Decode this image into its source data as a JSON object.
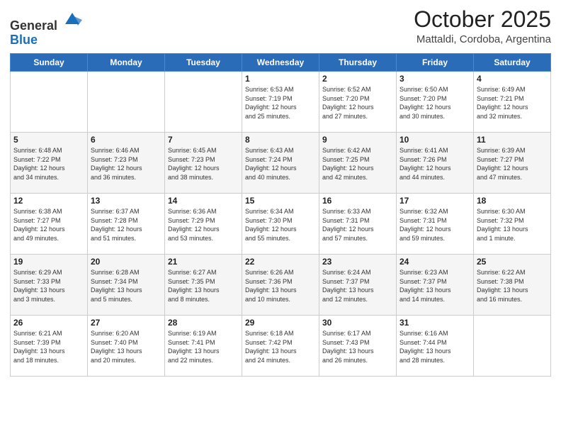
{
  "header": {
    "logo_line1": "General",
    "logo_line2": "Blue",
    "month": "October 2025",
    "location": "Mattaldi, Cordoba, Argentina"
  },
  "days_of_week": [
    "Sunday",
    "Monday",
    "Tuesday",
    "Wednesday",
    "Thursday",
    "Friday",
    "Saturday"
  ],
  "weeks": [
    [
      {
        "day": "",
        "info": ""
      },
      {
        "day": "",
        "info": ""
      },
      {
        "day": "",
        "info": ""
      },
      {
        "day": "1",
        "info": "Sunrise: 6:53 AM\nSunset: 7:19 PM\nDaylight: 12 hours\nand 25 minutes."
      },
      {
        "day": "2",
        "info": "Sunrise: 6:52 AM\nSunset: 7:20 PM\nDaylight: 12 hours\nand 27 minutes."
      },
      {
        "day": "3",
        "info": "Sunrise: 6:50 AM\nSunset: 7:20 PM\nDaylight: 12 hours\nand 30 minutes."
      },
      {
        "day": "4",
        "info": "Sunrise: 6:49 AM\nSunset: 7:21 PM\nDaylight: 12 hours\nand 32 minutes."
      }
    ],
    [
      {
        "day": "5",
        "info": "Sunrise: 6:48 AM\nSunset: 7:22 PM\nDaylight: 12 hours\nand 34 minutes."
      },
      {
        "day": "6",
        "info": "Sunrise: 6:46 AM\nSunset: 7:23 PM\nDaylight: 12 hours\nand 36 minutes."
      },
      {
        "day": "7",
        "info": "Sunrise: 6:45 AM\nSunset: 7:23 PM\nDaylight: 12 hours\nand 38 minutes."
      },
      {
        "day": "8",
        "info": "Sunrise: 6:43 AM\nSunset: 7:24 PM\nDaylight: 12 hours\nand 40 minutes."
      },
      {
        "day": "9",
        "info": "Sunrise: 6:42 AM\nSunset: 7:25 PM\nDaylight: 12 hours\nand 42 minutes."
      },
      {
        "day": "10",
        "info": "Sunrise: 6:41 AM\nSunset: 7:26 PM\nDaylight: 12 hours\nand 44 minutes."
      },
      {
        "day": "11",
        "info": "Sunrise: 6:39 AM\nSunset: 7:27 PM\nDaylight: 12 hours\nand 47 minutes."
      }
    ],
    [
      {
        "day": "12",
        "info": "Sunrise: 6:38 AM\nSunset: 7:27 PM\nDaylight: 12 hours\nand 49 minutes."
      },
      {
        "day": "13",
        "info": "Sunrise: 6:37 AM\nSunset: 7:28 PM\nDaylight: 12 hours\nand 51 minutes."
      },
      {
        "day": "14",
        "info": "Sunrise: 6:36 AM\nSunset: 7:29 PM\nDaylight: 12 hours\nand 53 minutes."
      },
      {
        "day": "15",
        "info": "Sunrise: 6:34 AM\nSunset: 7:30 PM\nDaylight: 12 hours\nand 55 minutes."
      },
      {
        "day": "16",
        "info": "Sunrise: 6:33 AM\nSunset: 7:31 PM\nDaylight: 12 hours\nand 57 minutes."
      },
      {
        "day": "17",
        "info": "Sunrise: 6:32 AM\nSunset: 7:31 PM\nDaylight: 12 hours\nand 59 minutes."
      },
      {
        "day": "18",
        "info": "Sunrise: 6:30 AM\nSunset: 7:32 PM\nDaylight: 13 hours\nand 1 minute."
      }
    ],
    [
      {
        "day": "19",
        "info": "Sunrise: 6:29 AM\nSunset: 7:33 PM\nDaylight: 13 hours\nand 3 minutes."
      },
      {
        "day": "20",
        "info": "Sunrise: 6:28 AM\nSunset: 7:34 PM\nDaylight: 13 hours\nand 5 minutes."
      },
      {
        "day": "21",
        "info": "Sunrise: 6:27 AM\nSunset: 7:35 PM\nDaylight: 13 hours\nand 8 minutes."
      },
      {
        "day": "22",
        "info": "Sunrise: 6:26 AM\nSunset: 7:36 PM\nDaylight: 13 hours\nand 10 minutes."
      },
      {
        "day": "23",
        "info": "Sunrise: 6:24 AM\nSunset: 7:37 PM\nDaylight: 13 hours\nand 12 minutes."
      },
      {
        "day": "24",
        "info": "Sunrise: 6:23 AM\nSunset: 7:37 PM\nDaylight: 13 hours\nand 14 minutes."
      },
      {
        "day": "25",
        "info": "Sunrise: 6:22 AM\nSunset: 7:38 PM\nDaylight: 13 hours\nand 16 minutes."
      }
    ],
    [
      {
        "day": "26",
        "info": "Sunrise: 6:21 AM\nSunset: 7:39 PM\nDaylight: 13 hours\nand 18 minutes."
      },
      {
        "day": "27",
        "info": "Sunrise: 6:20 AM\nSunset: 7:40 PM\nDaylight: 13 hours\nand 20 minutes."
      },
      {
        "day": "28",
        "info": "Sunrise: 6:19 AM\nSunset: 7:41 PM\nDaylight: 13 hours\nand 22 minutes."
      },
      {
        "day": "29",
        "info": "Sunrise: 6:18 AM\nSunset: 7:42 PM\nDaylight: 13 hours\nand 24 minutes."
      },
      {
        "day": "30",
        "info": "Sunrise: 6:17 AM\nSunset: 7:43 PM\nDaylight: 13 hours\nand 26 minutes."
      },
      {
        "day": "31",
        "info": "Sunrise: 6:16 AM\nSunset: 7:44 PM\nDaylight: 13 hours\nand 28 minutes."
      },
      {
        "day": "",
        "info": ""
      }
    ]
  ]
}
